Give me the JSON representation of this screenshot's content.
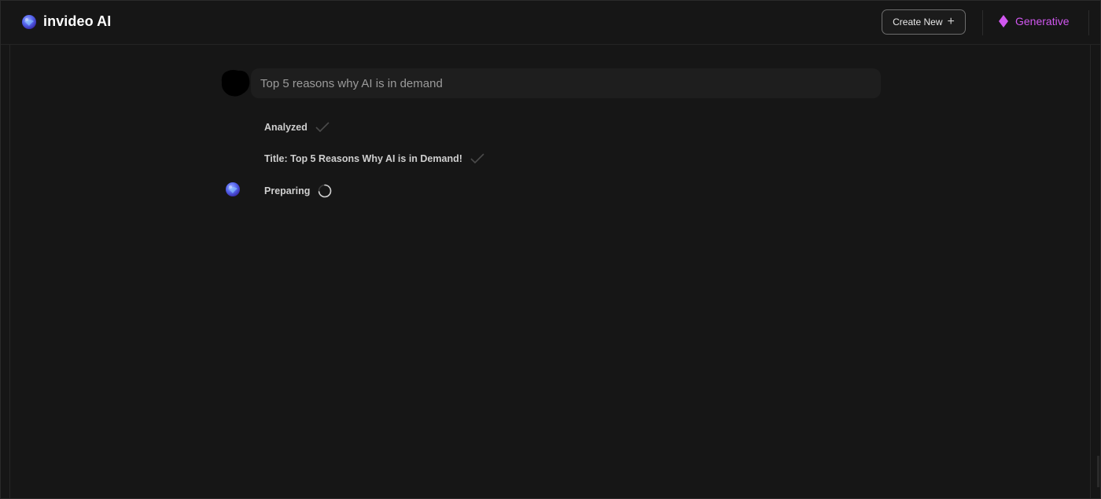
{
  "header": {
    "brand_name": "invideo AI",
    "create_label": "Create New",
    "create_icon": "plus-icon",
    "generative_label": "Generative",
    "generative_color": "#d157f0"
  },
  "chat": {
    "prompt": "Top 5 reasons why AI is in demand",
    "steps": [
      {
        "label": "Analyzed",
        "status": "done",
        "icon": "check-icon"
      },
      {
        "label": "Title: Top 5 Reasons Why AI is in Demand!",
        "status": "done",
        "icon": "check-icon"
      },
      {
        "label": "Preparing",
        "status": "in-progress",
        "icon": "spinner-icon"
      }
    ]
  },
  "colors": {
    "background": "#161616",
    "bubble": "#1e1e1e",
    "accent": "#d157f0",
    "logo": "#5b6cf0"
  }
}
